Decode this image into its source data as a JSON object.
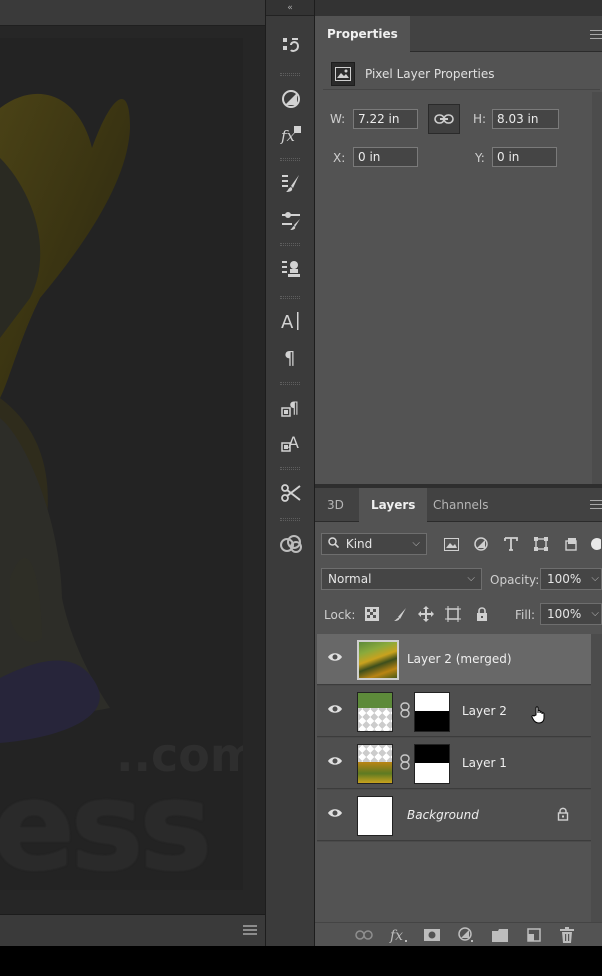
{
  "toolstrip": {
    "collapse_glyph": "«",
    "tools": [
      {
        "name": "history-icon"
      },
      {
        "name": "adjustments-icon"
      },
      {
        "name": "styles-icon"
      },
      {
        "name": "brush-presets-icon"
      },
      {
        "name": "brush-settings-icon"
      },
      {
        "name": "clone-source-icon"
      },
      {
        "name": "character-icon"
      },
      {
        "name": "paragraph-icon"
      },
      {
        "name": "paragraph-styles-icon"
      },
      {
        "name": "character-styles-icon"
      },
      {
        "name": "tool-presets-icon"
      },
      {
        "name": "creative-cloud-libraries-icon"
      }
    ]
  },
  "properties": {
    "tab_label": "Properties",
    "header_title": "Pixel Layer Properties",
    "w_label": "W:",
    "w_value": "7.22 in",
    "h_label": "H:",
    "h_value": "8.03 in",
    "x_label": "X:",
    "x_value": "0 in",
    "y_label": "Y:",
    "y_value": "0 in"
  },
  "layers_panel": {
    "tabs": [
      {
        "label": "3D",
        "active": false
      },
      {
        "label": "Layers",
        "active": true
      },
      {
        "label": "Channels",
        "active": false
      }
    ],
    "filter_kind": "Kind",
    "blend_mode": "Normal",
    "opacity_label": "Opacity:",
    "opacity_value": "100%",
    "lock_label": "Lock:",
    "fill_label": "Fill:",
    "fill_value": "100%",
    "layers": [
      {
        "name": "Layer 2 (merged)",
        "selected": true
      },
      {
        "name": "Layer 2",
        "selected": false
      },
      {
        "name": "Layer 1",
        "selected": false
      },
      {
        "name": "Background",
        "selected": false
      }
    ]
  },
  "canvas": {
    "watermark_small": "..com",
    "watermark_large": "ess"
  },
  "colors": {
    "panel_bg": "#535353",
    "selected_layer": "#686868",
    "canvas_bg": "#262626"
  }
}
